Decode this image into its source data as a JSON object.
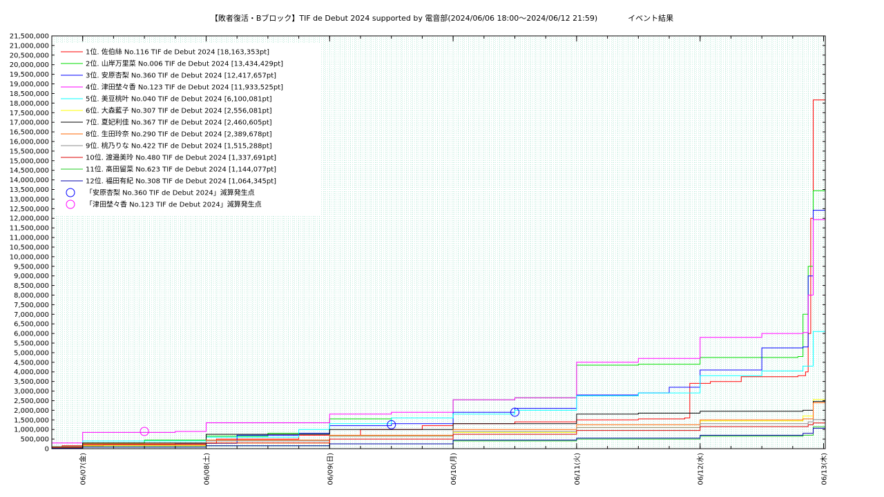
{
  "chart_data": {
    "type": "line",
    "title": "【敗者復活・Bブロック】TIF de Debut 2024 supported by 電音部(2024/06/06 18:00～2024/06/12 21:59)　　　　イベント結果",
    "xlabel": "",
    "ylabel": "",
    "ylim": [
      0,
      21500000
    ],
    "y_ticks": [
      0,
      500000,
      1000000,
      1500000,
      2000000,
      2500000,
      3000000,
      3500000,
      4000000,
      4500000,
      5000000,
      5500000,
      6000000,
      6500000,
      7000000,
      7500000,
      8000000,
      8500000,
      9000000,
      9500000,
      10000000,
      10500000,
      11000000,
      11500000,
      12000000,
      12500000,
      13000000,
      13500000,
      14000000,
      14500000,
      15000000,
      15500000,
      16000000,
      16500000,
      17000000,
      17500000,
      18000000,
      18500000,
      19000000,
      19500000,
      20000000,
      20500000,
      21000000,
      21500000
    ],
    "y_tick_labels": [
      "0",
      "500,000",
      "1,000,000",
      "1,500,000",
      "2,000,000",
      "2,500,000",
      "3,000,000",
      "3,500,000",
      "4,000,000",
      "4,500,000",
      "5,000,000",
      "5,500,000",
      "6,000,000",
      "6,500,000",
      "7,000,000",
      "7,500,000",
      "8,000,000",
      "8,500,000",
      "9,000,000",
      "9,500,000",
      "10,000,000",
      "10,500,000",
      "11,000,000",
      "11,500,000",
      "12,000,000",
      "12,500,000",
      "13,000,000",
      "13,500,000",
      "14,000,000",
      "14,500,000",
      "15,000,000",
      "15,500,000",
      "16,000,000",
      "16,500,000",
      "17,000,000",
      "17,500,000",
      "18,000,000",
      "18,500,000",
      "19,000,000",
      "19,500,000",
      "20,000,000",
      "20,500,000",
      "21,000,000",
      "21,500,000"
    ],
    "xlim": [
      "2024-06-06 18:00",
      "2024-06-13 00:20"
    ],
    "x_ticks": [
      "2024-06-07 00:00",
      "2024-06-08 00:00",
      "2024-06-09 00:00",
      "2024-06-10 00:00",
      "2024-06-11 00:00",
      "2024-06-12 00:00",
      "2024-06-13 00:00"
    ],
    "x_tick_labels": [
      "06/07(金)",
      "06/08(土)",
      "06/09(日)",
      "06/10(月)",
      "06/11(火)",
      "06/12(水)",
      "06/13(木)"
    ],
    "grid": true,
    "legend_position": "top-left",
    "series": [
      {
        "name": "1位. 佐伯絲 No.116 TIF de Debut 2024 [18,163,353pt]",
        "color": "#ff0000",
        "x": [
          "2024-06-06 18:00",
          "2024-06-06 20:00",
          "2024-06-07 04:00",
          "2024-06-07 18:00",
          "2024-06-08 02:00",
          "2024-06-08 18:00",
          "2024-06-09 06:00",
          "2024-06-09 18:00",
          "2024-06-10 00:00",
          "2024-06-10 12:00",
          "2024-06-11 00:00",
          "2024-06-11 12:00",
          "2024-06-11 21:00",
          "2024-06-11 22:00",
          "2024-06-12 02:00",
          "2024-06-12 08:00",
          "2024-06-12 19:00",
          "2024-06-12 20:30",
          "2024-06-12 21:00",
          "2024-06-12 21:30",
          "2024-06-12 21:59",
          "2024-06-13 00:20"
        ],
        "y": [
          50000,
          150000,
          200000,
          280000,
          500000,
          700000,
          1000000,
          1200000,
          1300000,
          1400000,
          1500000,
          1550000,
          1600000,
          3400000,
          3500000,
          3750000,
          3800000,
          4000000,
          6000000,
          12000000,
          18163353,
          18163353
        ]
      },
      {
        "name": "2位. 山岸万里菜 No.006 TIF de Debut 2024 [13,434,429pt]",
        "color": "#00dd00",
        "x": [
          "2024-06-06 18:00",
          "2024-06-07 00:00",
          "2024-06-07 12:00",
          "2024-06-08 00:00",
          "2024-06-08 12:00",
          "2024-06-09 00:00",
          "2024-06-09 12:00",
          "2024-06-10 00:00",
          "2024-06-10 12:00",
          "2024-06-11 00:00",
          "2024-06-11 12:00",
          "2024-06-12 00:00",
          "2024-06-12 19:00",
          "2024-06-12 20:00",
          "2024-06-12 21:00",
          "2024-06-12 21:59",
          "2024-06-13 00:20"
        ],
        "y": [
          100000,
          300000,
          450000,
          650000,
          800000,
          1550000,
          1600000,
          2550000,
          2650000,
          4350000,
          4400000,
          4750000,
          4800000,
          7000000,
          9500000,
          13434429,
          13434429
        ]
      },
      {
        "name": "3位. 安原杏梨 No.360 TIF de Debut 2024 [12,417,657pt]",
        "color": "#0000ff",
        "x": [
          "2024-06-06 18:00",
          "2024-06-07 00:00",
          "2024-06-07 18:00",
          "2024-06-08 06:00",
          "2024-06-08 18:00",
          "2024-06-09 00:00",
          "2024-06-09 12:00",
          "2024-06-10 00:00",
          "2024-06-10 12:00",
          "2024-06-11 00:00",
          "2024-06-11 12:00",
          "2024-06-11 18:00",
          "2024-06-12 00:00",
          "2024-06-12 12:00",
          "2024-06-12 20:00",
          "2024-06-12 21:00",
          "2024-06-12 21:59",
          "2024-06-13 00:20"
        ],
        "y": [
          50000,
          250000,
          280000,
          700000,
          800000,
          1200000,
          1300000,
          1900000,
          2100000,
          2800000,
          2900000,
          3200000,
          4100000,
          5250000,
          5300000,
          9000000,
          12417657,
          12417657
        ]
      },
      {
        "name": "4位. 津田埜々香 No.123 TIF de Debut 2024 [11,933,525pt]",
        "color": "#ff00ff",
        "x": [
          "2024-06-06 18:00",
          "2024-06-07 00:00",
          "2024-06-07 18:00",
          "2024-06-08 00:00",
          "2024-06-09 00:00",
          "2024-06-09 12:00",
          "2024-06-10 00:00",
          "2024-06-10 12:00",
          "2024-06-11 00:00",
          "2024-06-11 12:00",
          "2024-06-12 00:00",
          "2024-06-12 12:00",
          "2024-06-12 20:00",
          "2024-06-12 21:00",
          "2024-06-12 21:59",
          "2024-06-13 00:20"
        ],
        "y": [
          300000,
          850000,
          900000,
          1350000,
          1800000,
          1900000,
          2550000,
          2650000,
          4500000,
          4700000,
          5800000,
          6000000,
          6050000,
          8000000,
          11933525,
          11933525
        ]
      },
      {
        "name": "5位. 美豆桃叶 No.040 TIF de Debut 2024 [6,100,081pt]",
        "color": "#00ffff",
        "x": [
          "2024-06-06 18:00",
          "2024-06-07 00:00",
          "2024-06-08 00:00",
          "2024-06-08 18:00",
          "2024-06-09 00:00",
          "2024-06-09 12:00",
          "2024-06-10 00:00",
          "2024-06-10 12:00",
          "2024-06-11 00:00",
          "2024-06-11 12:00",
          "2024-06-12 00:00",
          "2024-06-12 12:00",
          "2024-06-12 20:00",
          "2024-06-12 21:59",
          "2024-06-13 00:20"
        ],
        "y": [
          100000,
          400000,
          600000,
          1000000,
          1300000,
          1600000,
          1800000,
          2000000,
          2750000,
          2900000,
          3800000,
          4050000,
          4300000,
          6100081,
          6100081
        ]
      },
      {
        "name": "6位. 大森藍子 No.307 TIF de Debut 2024 [2,556,081pt]",
        "color": "#ffff00",
        "x": [
          "2024-06-06 18:00",
          "2024-06-07 00:00",
          "2024-06-08 00:00",
          "2024-06-09 00:00",
          "2024-06-10 00:00",
          "2024-06-11 00:00",
          "2024-06-12 00:00",
          "2024-06-12 20:00",
          "2024-06-12 21:59",
          "2024-06-13 00:20"
        ],
        "y": [
          50000,
          150000,
          300000,
          650000,
          850000,
          1100000,
          1450000,
          1700000,
          2556081,
          2556081
        ]
      },
      {
        "name": "7位. 夏妃利佳 No.367 TIF de Debut 2024 [2,460,605pt]",
        "color": "#000000",
        "x": [
          "2024-06-06 18:00",
          "2024-06-07 00:00",
          "2024-06-08 00:00",
          "2024-06-09 00:00",
          "2024-06-10 00:00",
          "2024-06-11 00:00",
          "2024-06-11 12:00",
          "2024-06-12 00:00",
          "2024-06-12 20:00",
          "2024-06-12 21:59",
          "2024-06-13 00:20"
        ],
        "y": [
          100000,
          300000,
          750000,
          1000000,
          1300000,
          1800000,
          1850000,
          1950000,
          2000000,
          2460605,
          2460605
        ]
      },
      {
        "name": "8位. 生田玲奈 No.290 TIF de Debut 2024 [2,389,678pt]",
        "color": "#ff6600",
        "x": [
          "2024-06-06 18:00",
          "2024-06-07 00:00",
          "2024-06-08 00:00",
          "2024-06-09 00:00",
          "2024-06-10 00:00",
          "2024-06-11 00:00",
          "2024-06-12 00:00",
          "2024-06-12 20:00",
          "2024-06-12 21:59",
          "2024-06-13 00:20"
        ],
        "y": [
          80000,
          250000,
          450000,
          700000,
          1000000,
          1250000,
          1500000,
          1550000,
          2389678,
          2389678
        ]
      },
      {
        "name": "9位. 桃乃りな No.422 TIF de Debut 2024 [1,515,288pt]",
        "color": "#888888",
        "x": [
          "2024-06-06 18:00",
          "2024-06-07 00:00",
          "2024-06-08 00:00",
          "2024-06-09 00:00",
          "2024-06-10 00:00",
          "2024-06-11 00:00",
          "2024-06-12 00:00",
          "2024-06-12 21:00",
          "2024-06-12 21:59",
          "2024-06-13 00:20"
        ],
        "y": [
          50000,
          200000,
          400000,
          650000,
          900000,
          1100000,
          1300000,
          1400000,
          1515288,
          1515288
        ]
      },
      {
        "name": "10位. 渡邉美玲 No.480 TIF de Debut 2024 [1,337,691pt]",
        "color": "#dd0000",
        "x": [
          "2024-06-06 18:00",
          "2024-06-07 00:00",
          "2024-06-08 00:00",
          "2024-06-09 00:00",
          "2024-06-10 00:00",
          "2024-06-11 00:00",
          "2024-06-12 00:00",
          "2024-06-12 21:00",
          "2024-06-12 21:59",
          "2024-06-13 00:20"
        ],
        "y": [
          50000,
          200000,
          300000,
          500000,
          750000,
          950000,
          1150000,
          1250000,
          1337691,
          1337691
        ]
      },
      {
        "name": "11位. 髙田留菜 No.623 TIF de Debut 2024 [1,144,077pt]",
        "color": "#22cc22",
        "x": [
          "2024-06-06 18:00",
          "2024-06-07 00:00",
          "2024-06-08 00:00",
          "2024-06-09 00:00",
          "2024-06-10 00:00",
          "2024-06-11 00:00",
          "2024-06-12 00:00",
          "2024-06-12 20:00",
          "2024-06-12 21:59",
          "2024-06-13 00:20"
        ],
        "y": [
          30000,
          100000,
          150000,
          250000,
          400000,
          500000,
          650000,
          700000,
          1144077,
          1144077
        ]
      },
      {
        "name": "12位. 福田有紀 No.308 TIF de Debut 2024 [1,064,345pt]",
        "color": "#0000aa",
        "x": [
          "2024-06-06 18:00",
          "2024-06-07 00:00",
          "2024-06-08 00:00",
          "2024-06-09 00:00",
          "2024-06-10 00:00",
          "2024-06-11 00:00",
          "2024-06-12 00:00",
          "2024-06-12 20:00",
          "2024-06-12 21:59",
          "2024-06-13 00:20"
        ],
        "y": [
          30000,
          80000,
          150000,
          250000,
          450000,
          550000,
          700000,
          800000,
          1064345,
          1064345
        ]
      }
    ],
    "markers": [
      {
        "name": "「安原杏梨 No.360 TIF de Debut 2024」減算発生点",
        "color": "#0000ff",
        "points": [
          {
            "x": "2024-06-09 12:00",
            "y": 1250000
          },
          {
            "x": "2024-06-10 12:00",
            "y": 1900000
          }
        ]
      },
      {
        "name": "「津田埜々香 No.123 TIF de Debut 2024」減算発生点",
        "color": "#ff00ff",
        "points": [
          {
            "x": "2024-06-07 12:00",
            "y": 900000
          }
        ]
      }
    ]
  }
}
